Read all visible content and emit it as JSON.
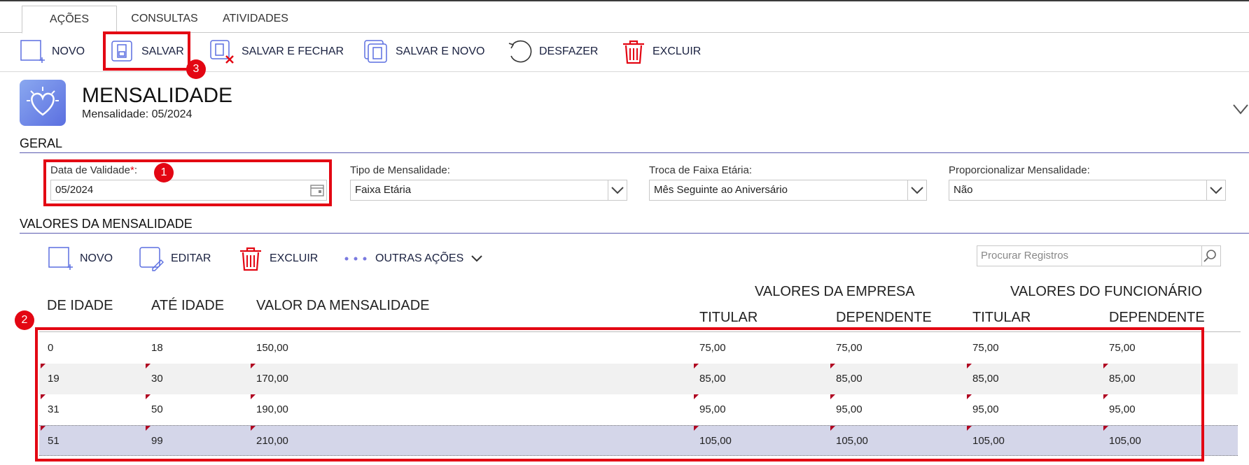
{
  "tabs": [
    {
      "label": "AÇÕES",
      "active": true
    },
    {
      "label": "CONSULTAS"
    },
    {
      "label": "ATIVIDADES"
    }
  ],
  "toolbar": {
    "novo": "NOVO",
    "salvar": "SALVAR",
    "salvar_fechar": "SALVAR E FECHAR",
    "salvar_novo": "SALVAR E NOVO",
    "desfazer": "DESFAZER",
    "excluir": "EXCLUIR"
  },
  "header": {
    "title": "MENSALIDADE",
    "subtitle": "Mensalidade: 05/2024"
  },
  "geral": {
    "section": "GERAL",
    "data_validade": {
      "label": "Data de Validade",
      "required": "*",
      "suffix": ":",
      "value": "05/2024"
    },
    "tipo": {
      "label": "Tipo de Mensalidade:",
      "value": "Faixa Etária"
    },
    "troca": {
      "label": "Troca de Faixa Etária:",
      "value": "Mês Seguinte ao Aniversário"
    },
    "proporcional": {
      "label": "Proporcionalizar Mensalidade:",
      "value": "Não"
    }
  },
  "valores": {
    "section": "VALORES DA MENSALIDADE",
    "actions": {
      "novo": "NOVO",
      "editar": "EDITAR",
      "excluir": "EXCLUIR",
      "outras": "OUTRAS AÇÕES"
    },
    "search_placeholder": "Procurar Registros",
    "columns": {
      "de_idade": "DE IDADE",
      "ate_idade": "ATÉ IDADE",
      "valor": "VALOR DA MENSALIDADE",
      "grupo_empresa": "VALORES DA EMPRESA",
      "grupo_funcionario": "VALORES DO FUNCIONÁRIO",
      "titular": "TITULAR",
      "dependente": "DEPENDENTE"
    },
    "rows": [
      {
        "de": "0",
        "ate": "18",
        "valor": "150,00",
        "emp_tit": "75,00",
        "emp_dep": "75,00",
        "fun_tit": "75,00",
        "fun_dep": "75,00"
      },
      {
        "de": "19",
        "ate": "30",
        "valor": "170,00",
        "emp_tit": "85,00",
        "emp_dep": "85,00",
        "fun_tit": "85,00",
        "fun_dep": "85,00"
      },
      {
        "de": "31",
        "ate": "50",
        "valor": "190,00",
        "emp_tit": "95,00",
        "emp_dep": "95,00",
        "fun_tit": "95,00",
        "fun_dep": "95,00"
      },
      {
        "de": "51",
        "ate": "99",
        "valor": "210,00",
        "emp_tit": "105,00",
        "emp_dep": "105,00",
        "fun_tit": "105,00",
        "fun_dep": "105,00"
      }
    ]
  },
  "annotations": {
    "b1": "1",
    "b2": "2",
    "b3": "3"
  },
  "colors": {
    "accent": "#e30613",
    "brand": "#5b6fe0",
    "selected_row": "#d4d6e9",
    "striped_row": "#f1f1f1"
  }
}
